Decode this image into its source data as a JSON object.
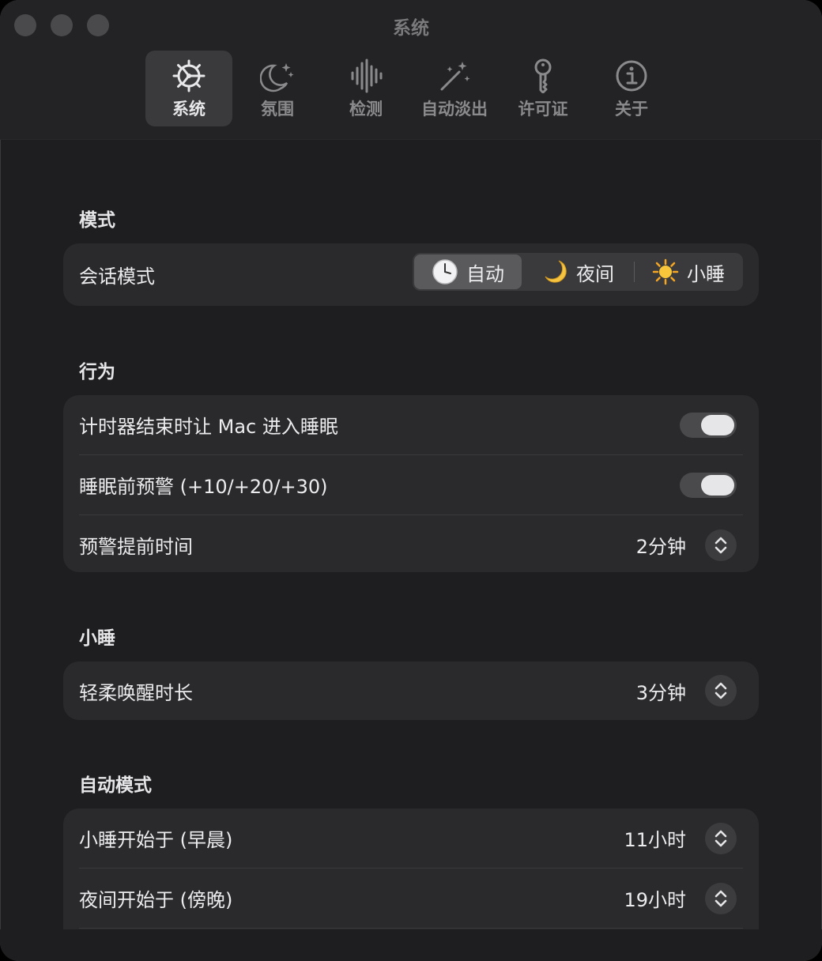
{
  "window": {
    "title": "系统"
  },
  "toolbar": {
    "tabs": [
      {
        "label": "系统",
        "icon": "gear-icon",
        "active": true
      },
      {
        "label": "氛围",
        "icon": "moon-stars-icon",
        "active": false
      },
      {
        "label": "检测",
        "icon": "waveform-icon",
        "active": false
      },
      {
        "label": "自动淡出",
        "icon": "magic-wand-icon",
        "active": false
      },
      {
        "label": "许可证",
        "icon": "key-icon",
        "active": false
      },
      {
        "label": "关于",
        "icon": "info-icon",
        "active": false
      }
    ]
  },
  "sections": {
    "mode": {
      "title": "模式",
      "session_mode": {
        "label": "会话模式",
        "options": [
          {
            "label": "自动",
            "icon": "clock-icon",
            "selected": true
          },
          {
            "label": "夜间",
            "icon": "crescent-moon-icon",
            "selected": false
          },
          {
            "label": "小睡",
            "icon": "sun-icon",
            "selected": false
          }
        ]
      }
    },
    "behavior": {
      "title": "行为",
      "sleep_mac": {
        "label": "计时器结束时让 Mac 进入睡眠",
        "on": true
      },
      "pre_warn": {
        "label": "睡眠前预警 (+10/+20/+30)",
        "on": true
      },
      "warn_lead": {
        "label": "预警提前时间",
        "value": "2分钟"
      }
    },
    "nap": {
      "title": "小睡",
      "gentle_wake": {
        "label": "轻柔唤醒时长",
        "value": "3分钟"
      }
    },
    "auto_mode": {
      "title": "自动模式",
      "nap_start": {
        "label": "小睡开始于 (早晨)",
        "value": "11小时"
      },
      "night_start": {
        "label": "夜间开始于 (傍晚)",
        "value": "19小时"
      }
    }
  },
  "colors": {
    "window_bg": "#1e1e20",
    "card_bg": "#2a2a2c",
    "selected_bg": "#3a3a3c",
    "text": "#ececee",
    "muted": "#8a8a8c"
  }
}
